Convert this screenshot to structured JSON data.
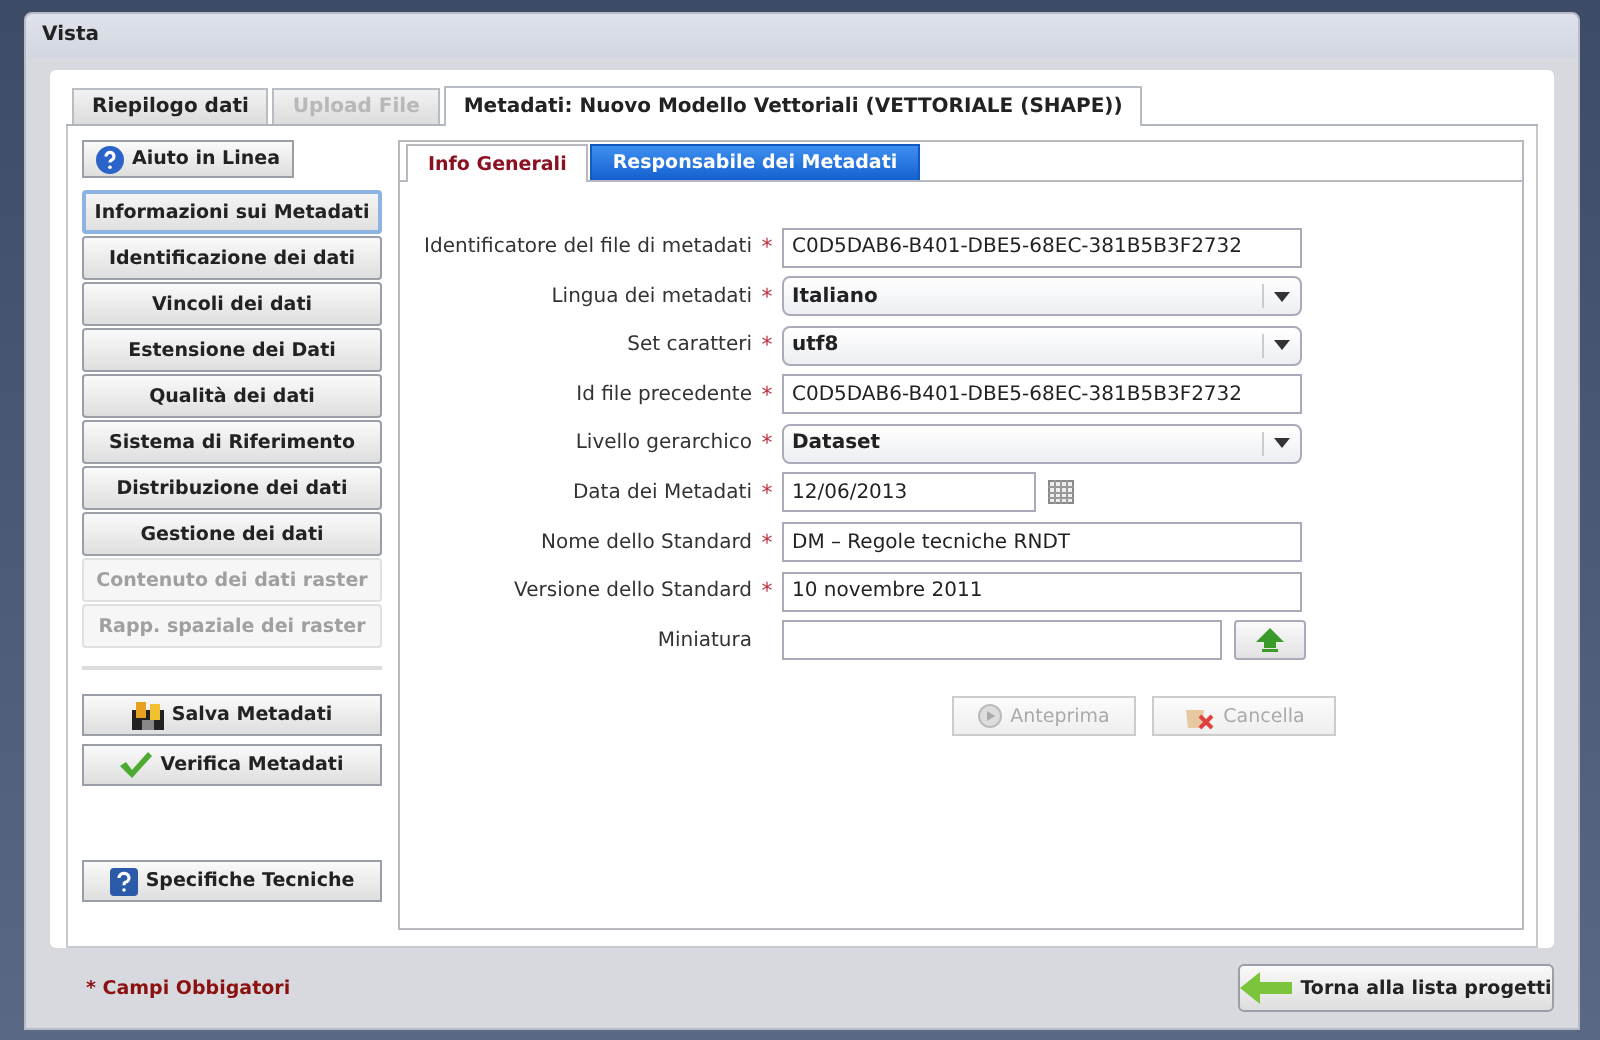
{
  "window": {
    "title": "Vista"
  },
  "tabs": [
    {
      "label": "Riepilogo dati",
      "selected": false,
      "disabled": false
    },
    {
      "label": "Upload File",
      "selected": false,
      "disabled": true
    },
    {
      "label": "Metadati: Nuovo Modello Vettoriali (VETTORIALE (SHAPE))",
      "selected": true,
      "disabled": false
    }
  ],
  "sidebar": {
    "help_button": "Aiuto in Linea",
    "sections": [
      {
        "label": "Informazioni sui Metadati",
        "selected": true,
        "disabled": false
      },
      {
        "label": "Identificazione dei dati",
        "selected": false,
        "disabled": false
      },
      {
        "label": "Vincoli dei dati",
        "selected": false,
        "disabled": false
      },
      {
        "label": "Estensione dei Dati",
        "selected": false,
        "disabled": false
      },
      {
        "label": "Qualità dei dati",
        "selected": false,
        "disabled": false
      },
      {
        "label": "Sistema di Riferimento",
        "selected": false,
        "disabled": false
      },
      {
        "label": "Distribuzione dei dati",
        "selected": false,
        "disabled": false
      },
      {
        "label": "Gestione dei dati",
        "selected": false,
        "disabled": false
      },
      {
        "label": "Contenuto dei dati raster",
        "selected": false,
        "disabled": true
      },
      {
        "label": "Rapp. spaziale dei raster",
        "selected": false,
        "disabled": true
      }
    ],
    "actions": [
      {
        "label": "Salva Metadati",
        "kind": "save"
      },
      {
        "label": "Verifica Metadati",
        "kind": "verify"
      }
    ],
    "spec_button": "Specifiche Tecniche"
  },
  "subtabs": [
    {
      "label": "Info Generali",
      "selected": true
    },
    {
      "label": "Responsabile dei Metadati",
      "selected": false
    }
  ],
  "form": {
    "fields": [
      {
        "label": "Identificatore del file di metadati",
        "marker": "*",
        "kind": "text",
        "value": "C0D5DAB6-B401-DBE5-68EC-381B5B3F2732"
      },
      {
        "label": "Lingua dei metadati",
        "marker": "*",
        "kind": "select",
        "value": "Italiano"
      },
      {
        "label": "Set caratteri",
        "marker": "*",
        "kind": "select",
        "value": "utf8"
      },
      {
        "label": "Id file precedente",
        "marker": "*",
        "kind": "text",
        "value": "C0D5DAB6-B401-DBE5-68EC-381B5B3F2732"
      },
      {
        "label": "Livello gerarchico",
        "marker": "*",
        "kind": "select",
        "value": "Dataset"
      },
      {
        "label": "Data dei Metadati",
        "marker": "*",
        "kind": "date",
        "value": "12/06/2013"
      },
      {
        "label": "Nome dello Standard",
        "marker": "*",
        "kind": "text",
        "value": "DM – Regole tecniche RNDT"
      },
      {
        "label": "Versione dello Standard",
        "marker": "*",
        "kind": "text",
        "value": "10 novembre 2011"
      },
      {
        "label": "Miniatura",
        "kind": "file"
      }
    ],
    "buttons": [
      {
        "label": "Anteprima",
        "kind": "preview",
        "disabled": true
      },
      {
        "label": "Cancella",
        "kind": "delete",
        "disabled": true
      }
    ]
  },
  "footer": {
    "note": "* Campi Obbigatori",
    "back_button": "Torna alla lista progetti"
  }
}
